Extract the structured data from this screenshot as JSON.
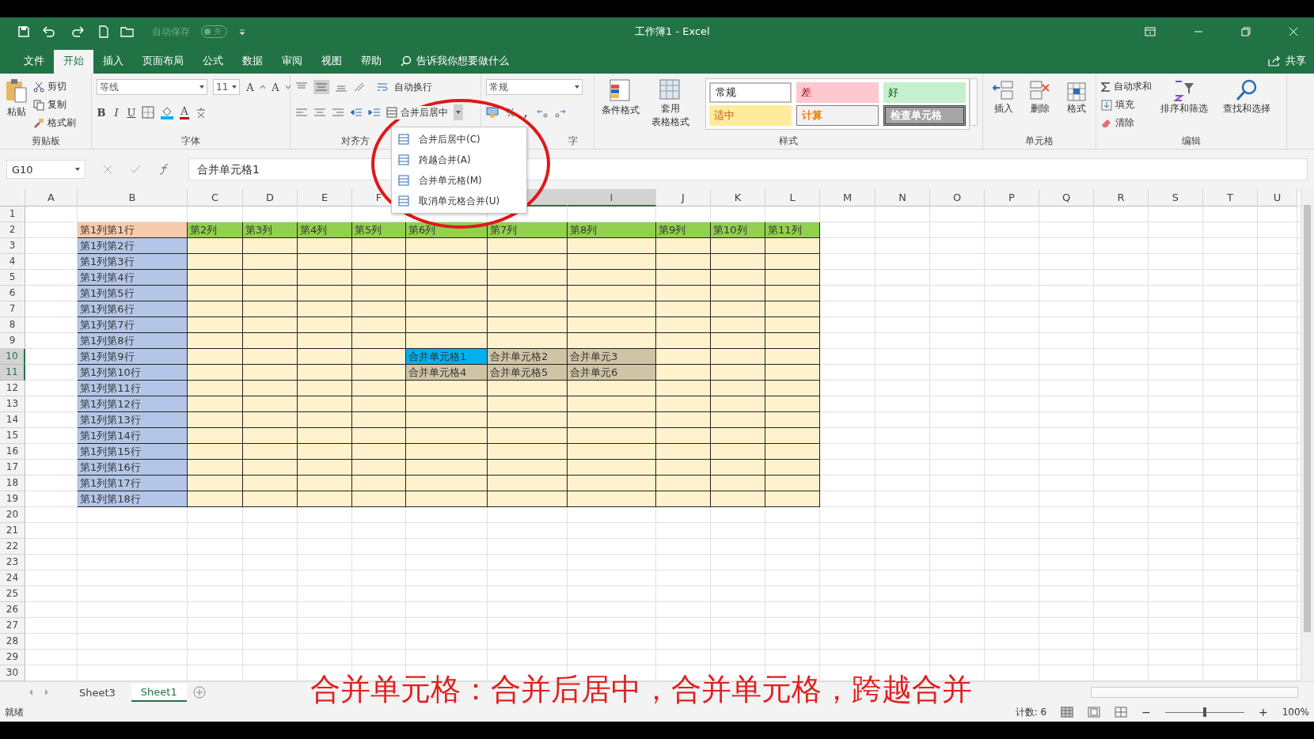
{
  "title_bar": {
    "autosave_label": "自动保存",
    "autosave_on": false,
    "autosave_state": "关",
    "title": "工作簿1 - Excel"
  },
  "tabs": [
    {
      "label": "文件",
      "selected": false
    },
    {
      "label": "开始",
      "selected": true
    },
    {
      "label": "插入",
      "selected": false
    },
    {
      "label": "页面布局",
      "selected": false
    },
    {
      "label": "公式",
      "selected": false
    },
    {
      "label": "数据",
      "selected": false
    },
    {
      "label": "审阅",
      "selected": false
    },
    {
      "label": "视图",
      "selected": false
    },
    {
      "label": "帮助",
      "selected": false
    }
  ],
  "tell_me": "告诉我你想要做什么",
  "share": "共享",
  "clipboard": {
    "paste": "粘贴",
    "cut": "剪切",
    "copy": "复制",
    "painter": "格式刷",
    "label": "剪贴板"
  },
  "font": {
    "name": "等线",
    "size": "11",
    "grow": "A",
    "shrink": "A",
    "bold": "B",
    "italic": "I",
    "underline": "U",
    "color_button": "A",
    "label": "字体"
  },
  "alignment": {
    "wrap": "自动换行",
    "merge": "合并后居中",
    "label": "对齐方"
  },
  "number": {
    "format": "常规",
    "percent": "%",
    "comma": ",",
    "label": "字"
  },
  "styles": {
    "conditional": "条件格式",
    "table_1": "套用",
    "table_2": "表格格式",
    "label": "样式",
    "gallery": [
      {
        "text": "常规",
        "kind": "normal"
      },
      {
        "text": "差",
        "kind": "bad"
      },
      {
        "text": "好",
        "kind": "good"
      },
      {
        "text": "适中",
        "kind": "neutral"
      },
      {
        "text": "计算",
        "kind": "calc"
      },
      {
        "text": "检查单元格",
        "kind": "check"
      }
    ]
  },
  "cells_group": {
    "insert": "插入",
    "delete": "删除",
    "format": "格式",
    "label": "单元格"
  },
  "editing": {
    "autosum": "自动求和",
    "fill": "填充",
    "clear": "清除",
    "sort": "排序和筛选",
    "find": "查找和选择",
    "label": "编辑"
  },
  "merge_menu": [
    "合并后居中(C)",
    "跨越合并(A)",
    "合并单元格(M)",
    "取消单元格合并(U)"
  ],
  "formula_bar": {
    "name_box": "G10",
    "formula": "合并单元格1"
  },
  "columns": [
    {
      "label": "A",
      "selected": false
    },
    {
      "label": "B",
      "selected": false
    },
    {
      "label": "C",
      "selected": false
    },
    {
      "label": "D",
      "selected": false
    },
    {
      "label": "E",
      "selected": false
    },
    {
      "label": "F",
      "selected": false
    },
    {},
    {
      "selected": true
    },
    {
      "label": "I",
      "selected": true
    },
    {
      "label": "J",
      "selected": false
    },
    {
      "label": "K",
      "selected": false
    },
    {
      "label": "L",
      "selected": false
    },
    {
      "label": "M",
      "selected": false
    },
    {
      "label": "N",
      "selected": false
    },
    {
      "label": "O",
      "selected": false
    },
    {
      "label": "P",
      "selected": false
    },
    {
      "label": "Q",
      "selected": false
    },
    {
      "label": "R",
      "selected": false
    },
    {
      "label": "S",
      "selected": false
    },
    {
      "label": "T",
      "selected": false
    },
    {
      "label": "U",
      "selected": false
    }
  ],
  "rows": [
    {
      "number": "1",
      "selected": false
    },
    {
      "number": "2",
      "selected": false,
      "cells": [
        {
          "text": "第1列第1行",
          "kind": "corner"
        },
        {
          "text": "第2列",
          "kind": "header"
        },
        {
          "text": "第3列",
          "kind": "header"
        },
        {
          "text": "第4列",
          "kind": "header"
        },
        {
          "text": "第5列",
          "kind": "header"
        },
        {
          "text": "第6列",
          "kind": "header"
        },
        {
          "text": "第7列",
          "kind": "header"
        },
        {
          "text": "第8列",
          "kind": "header"
        },
        {
          "text": "第9列",
          "kind": "header"
        },
        {
          "text": "第10列",
          "kind": "header"
        },
        {
          "text": "第11列",
          "kind": "header"
        }
      ]
    },
    {
      "number": "3",
      "selected": false,
      "cells": [
        {
          "text": "第1列第2行",
          "kind": "rowhead"
        },
        {
          "kind": "body"
        },
        {
          "kind": "body"
        },
        {
          "kind": "body"
        },
        {
          "kind": "body"
        },
        {
          "kind": "body"
        },
        {
          "kind": "body"
        },
        {
          "kind": "body"
        },
        {
          "kind": "body"
        },
        {
          "kind": "body"
        },
        {
          "kind": "body"
        }
      ]
    },
    {
      "number": "4",
      "selected": false,
      "cells": [
        {
          "text": "第1列第3行",
          "kind": "rowhead"
        },
        {
          "kind": "body"
        },
        {
          "kind": "body"
        },
        {
          "kind": "body"
        },
        {
          "kind": "body"
        },
        {
          "kind": "body"
        },
        {
          "kind": "body"
        },
        {
          "kind": "body"
        },
        {
          "kind": "body"
        },
        {
          "kind": "body"
        },
        {
          "kind": "body"
        }
      ]
    },
    {
      "number": "5",
      "selected": false,
      "cells": [
        {
          "text": "第1列第4行",
          "kind": "rowhead"
        },
        {
          "kind": "body"
        },
        {
          "kind": "body"
        },
        {
          "kind": "body"
        },
        {
          "kind": "body"
        },
        {
          "kind": "body"
        },
        {
          "kind": "body"
        },
        {
          "kind": "body"
        },
        {
          "kind": "body"
        },
        {
          "kind": "body"
        },
        {
          "kind": "body"
        }
      ]
    },
    {
      "number": "6",
      "selected": false,
      "cells": [
        {
          "text": "第1列第5行",
          "kind": "rowhead"
        },
        {
          "kind": "body"
        },
        {
          "kind": "body"
        },
        {
          "kind": "body"
        },
        {
          "kind": "body"
        },
        {
          "kind": "body"
        },
        {
          "kind": "body"
        },
        {
          "kind": "body"
        },
        {
          "kind": "body"
        },
        {
          "kind": "body"
        },
        {
          "kind": "body"
        }
      ]
    },
    {
      "number": "7",
      "selected": false,
      "cells": [
        {
          "text": "第1列第6行",
          "kind": "rowhead"
        },
        {
          "kind": "body"
        },
        {
          "kind": "body"
        },
        {
          "kind": "body"
        },
        {
          "kind": "body"
        },
        {
          "kind": "body"
        },
        {
          "kind": "body"
        },
        {
          "kind": "body"
        },
        {
          "kind": "body"
        },
        {
          "kind": "body"
        },
        {
          "kind": "body"
        }
      ]
    },
    {
      "number": "8",
      "selected": false,
      "cells": [
        {
          "text": "第1列第7行",
          "kind": "rowhead"
        },
        {
          "kind": "body"
        },
        {
          "kind": "body"
        },
        {
          "kind": "body"
        },
        {
          "kind": "body"
        },
        {
          "kind": "body"
        },
        {
          "kind": "body"
        },
        {
          "kind": "body"
        },
        {
          "kind": "body"
        },
        {
          "kind": "body"
        },
        {
          "kind": "body"
        }
      ]
    },
    {
      "number": "9",
      "selected": false,
      "cells": [
        {
          "text": "第1列第8行",
          "kind": "rowhead"
        },
        {
          "kind": "body"
        },
        {
          "kind": "body"
        },
        {
          "kind": "body"
        },
        {
          "kind": "body"
        },
        {
          "kind": "body"
        },
        {
          "kind": "body"
        },
        {
          "kind": "body"
        },
        {
          "kind": "body"
        },
        {
          "kind": "body"
        },
        {
          "kind": "body"
        }
      ]
    },
    {
      "number": "10",
      "selected": true,
      "cells": [
        {
          "text": "第1列第9行",
          "kind": "rowhead"
        },
        {
          "kind": "body"
        },
        {
          "kind": "body"
        },
        {
          "kind": "body"
        },
        {
          "kind": "body"
        },
        {
          "text": "合并单元格1",
          "kind": "active"
        },
        {
          "text": "合并单元格2",
          "kind": "selected"
        },
        {
          "text": "合并单元3",
          "kind": "selected"
        },
        {
          "kind": "body"
        },
        {
          "kind": "body"
        },
        {
          "kind": "body"
        }
      ]
    },
    {
      "number": "11",
      "selected": true,
      "cells": [
        {
          "text": "第1列第10行",
          "kind": "rowhead"
        },
        {
          "kind": "body"
        },
        {
          "kind": "body"
        },
        {
          "kind": "body"
        },
        {
          "kind": "body"
        },
        {
          "text": "合并单元格4",
          "kind": "selected"
        },
        {
          "text": "合并单元格5",
          "kind": "selected"
        },
        {
          "text": "合并单元6",
          "kind": "selected"
        },
        {
          "kind": "body"
        },
        {
          "kind": "body"
        },
        {
          "kind": "body"
        }
      ]
    },
    {
      "number": "12",
      "selected": false,
      "cells": [
        {
          "text": "第1列第11行",
          "kind": "rowhead"
        },
        {
          "kind": "body"
        },
        {
          "kind": "body"
        },
        {
          "kind": "body"
        },
        {
          "kind": "body"
        },
        {
          "kind": "body"
        },
        {
          "kind": "body"
        },
        {
          "kind": "body"
        },
        {
          "kind": "body"
        },
        {
          "kind": "body"
        },
        {
          "kind": "body"
        }
      ]
    },
    {
      "number": "13",
      "selected": false,
      "cells": [
        {
          "text": "第1列第12行",
          "kind": "rowhead"
        },
        {
          "kind": "body"
        },
        {
          "kind": "body"
        },
        {
          "kind": "body"
        },
        {
          "kind": "body"
        },
        {
          "kind": "body"
        },
        {
          "kind": "body"
        },
        {
          "kind": "body"
        },
        {
          "kind": "body"
        },
        {
          "kind": "body"
        },
        {
          "kind": "body"
        }
      ]
    },
    {
      "number": "14",
      "selected": false,
      "cells": [
        {
          "text": "第1列第13行",
          "kind": "rowhead"
        },
        {
          "kind": "body"
        },
        {
          "kind": "body"
        },
        {
          "kind": "body"
        },
        {
          "kind": "body"
        },
        {
          "kind": "body"
        },
        {
          "kind": "body"
        },
        {
          "kind": "body"
        },
        {
          "kind": "body"
        },
        {
          "kind": "body"
        },
        {
          "kind": "body"
        }
      ]
    },
    {
      "number": "15",
      "selected": false,
      "cells": [
        {
          "text": "第1列第14行",
          "kind": "rowhead"
        },
        {
          "kind": "body"
        },
        {
          "kind": "body"
        },
        {
          "kind": "body"
        },
        {
          "kind": "body"
        },
        {
          "kind": "body"
        },
        {
          "kind": "body"
        },
        {
          "kind": "body"
        },
        {
          "kind": "body"
        },
        {
          "kind": "body"
        },
        {
          "kind": "body"
        }
      ]
    },
    {
      "number": "16",
      "selected": false,
      "cells": [
        {
          "text": "第1列第15行",
          "kind": "rowhead"
        },
        {
          "kind": "body"
        },
        {
          "kind": "body"
        },
        {
          "kind": "body"
        },
        {
          "kind": "body"
        },
        {
          "kind": "body"
        },
        {
          "kind": "body"
        },
        {
          "kind": "body"
        },
        {
          "kind": "body"
        },
        {
          "kind": "body"
        },
        {
          "kind": "body"
        }
      ]
    },
    {
      "number": "17",
      "selected": false,
      "cells": [
        {
          "text": "第1列第16行",
          "kind": "rowhead"
        },
        {
          "kind": "body"
        },
        {
          "kind": "body"
        },
        {
          "kind": "body"
        },
        {
          "kind": "body"
        },
        {
          "kind": "body"
        },
        {
          "kind": "body"
        },
        {
          "kind": "body"
        },
        {
          "kind": "body"
        },
        {
          "kind": "body"
        },
        {
          "kind": "body"
        }
      ]
    },
    {
      "number": "18",
      "selected": false,
      "cells": [
        {
          "text": "第1列第17行",
          "kind": "rowhead"
        },
        {
          "kind": "body"
        },
        {
          "kind": "body"
        },
        {
          "kind": "body"
        },
        {
          "kind": "body"
        },
        {
          "kind": "body"
        },
        {
          "kind": "body"
        },
        {
          "kind": "body"
        },
        {
          "kind": "body"
        },
        {
          "kind": "body"
        },
        {
          "kind": "body"
        }
      ]
    },
    {
      "number": "19",
      "selected": false,
      "cells": [
        {
          "text": "第1列第18行",
          "kind": "rowhead"
        },
        {
          "kind": "body"
        },
        {
          "kind": "body"
        },
        {
          "kind": "body"
        },
        {
          "kind": "body"
        },
        {
          "kind": "body"
        },
        {
          "kind": "body"
        },
        {
          "kind": "body"
        },
        {
          "kind": "body"
        },
        {
          "kind": "body"
        },
        {
          "kind": "body"
        }
      ]
    },
    {
      "number": "20",
      "selected": false
    },
    {
      "number": "21",
      "selected": false
    },
    {
      "number": "22",
      "selected": false
    },
    {
      "number": "23",
      "selected": false
    },
    {
      "number": "24",
      "selected": false
    },
    {
      "number": "25",
      "selected": false
    },
    {
      "number": "26",
      "selected": false
    },
    {
      "number": "27",
      "selected": false
    },
    {
      "number": "28",
      "selected": false
    },
    {
      "number": "29",
      "selected": false
    },
    {
      "number": "30",
      "selected": false
    }
  ],
  "sheet_tabs": [
    {
      "label": "Sheet3",
      "selected": false
    },
    {
      "label": "Sheet1",
      "selected": true
    }
  ],
  "caption": "合并单元格：合并后居中，合并单元格，跨越合并",
  "status_bar": {
    "ready": "就绪",
    "count": "计数: 6",
    "zoom_out": "−",
    "level": 0.5,
    "zoom_in": "+",
    "zoom": "100%"
  }
}
